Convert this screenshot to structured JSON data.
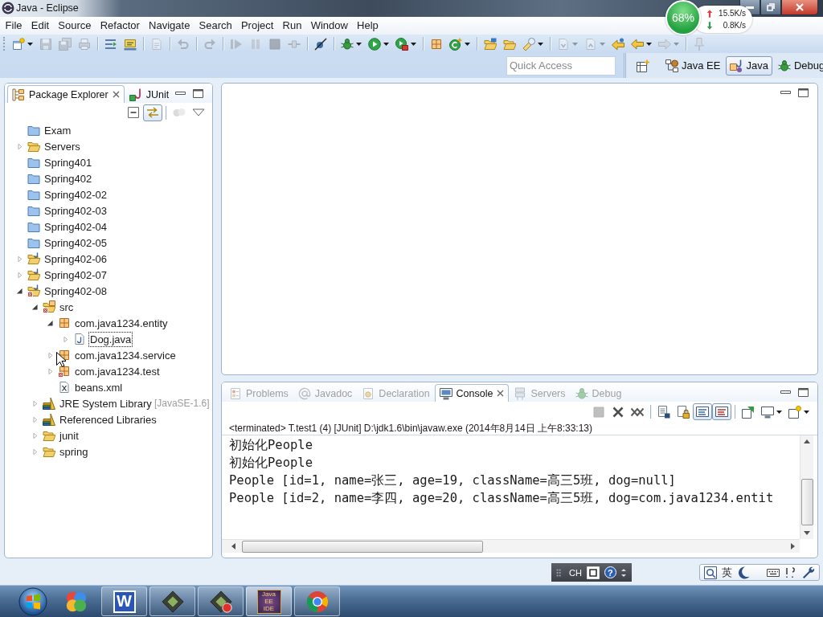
{
  "window": {
    "title": "Java - Eclipse"
  },
  "net_monitor": {
    "percent": "68%",
    "upload": "15.5K/s",
    "download": "0.8K/s"
  },
  "menu": [
    "File",
    "Edit",
    "Source",
    "Refactor",
    "Navigate",
    "Search",
    "Project",
    "Run",
    "Window",
    "Help"
  ],
  "toolbar": [
    [
      {
        "kind": "new",
        "disabled": false,
        "dropdown": true
      },
      {
        "kind": "save",
        "disabled": true,
        "dropdown": false
      },
      {
        "kind": "save-all",
        "disabled": true,
        "dropdown": false
      },
      {
        "kind": "print",
        "disabled": true,
        "dropdown": false
      }
    ],
    [
      {
        "kind": "lines",
        "disabled": false,
        "dropdown": false
      },
      {
        "kind": "tasks",
        "disabled": false,
        "dropdown": false
      }
    ],
    [
      {
        "kind": "page",
        "disabled": true,
        "dropdown": false
      }
    ],
    [
      {
        "kind": "undo",
        "disabled": true,
        "dropdown": false
      }
    ],
    [
      {
        "kind": "redo",
        "disabled": true,
        "dropdown": false
      }
    ],
    [
      {
        "kind": "resume",
        "disabled": true,
        "dropdown": false
      },
      {
        "kind": "suspend",
        "disabled": true,
        "dropdown": false
      },
      {
        "kind": "terminate",
        "disabled": true,
        "dropdown": false
      },
      {
        "kind": "disconnect",
        "disabled": true,
        "dropdown": false
      }
    ],
    [
      {
        "kind": "skip",
        "disabled": false,
        "dropdown": false
      }
    ],
    [
      {
        "kind": "debug",
        "disabled": false,
        "dropdown": true
      },
      {
        "kind": "run",
        "disabled": false,
        "dropdown": true
      },
      {
        "kind": "external",
        "disabled": false,
        "dropdown": true
      }
    ],
    [
      {
        "kind": "package",
        "disabled": false,
        "dropdown": false
      },
      {
        "kind": "class",
        "disabled": false,
        "dropdown": true
      }
    ],
    [
      {
        "kind": "open-type",
        "disabled": false,
        "dropdown": false
      },
      {
        "kind": "folder",
        "disabled": false,
        "dropdown": false
      },
      {
        "kind": "search",
        "disabled": false,
        "dropdown": true
      }
    ],
    [
      {
        "kind": "next",
        "disabled": true,
        "dropdown": true
      },
      {
        "kind": "prev",
        "disabled": true,
        "dropdown": true
      },
      {
        "kind": "last-edit",
        "disabled": false,
        "dropdown": false
      },
      {
        "kind": "back",
        "disabled": false,
        "dropdown": true
      },
      {
        "kind": "forward",
        "disabled": true,
        "dropdown": true
      }
    ],
    [
      {
        "kind": "pin",
        "disabled": true,
        "dropdown": false
      }
    ]
  ],
  "quick_access": {
    "placeholder": "Quick Access"
  },
  "perspectives": [
    {
      "kind": "javaee",
      "label": "Java EE",
      "selected": false
    },
    {
      "kind": "java",
      "label": "Java",
      "selected": true
    },
    {
      "kind": "debug",
      "label": "Debug",
      "selected": false
    }
  ],
  "package_explorer": {
    "tabs": [
      {
        "kind": "packages",
        "label": "Package Explorer",
        "selected": true
      },
      {
        "kind": "junit",
        "label": "JUnit",
        "selected": false
      }
    ],
    "view_toolbar": [
      [
        {
          "kind": "collapse",
          "disabled": false,
          "pressed": false
        },
        {
          "kind": "link",
          "disabled": false,
          "pressed": true
        }
      ],
      [
        {
          "kind": "focus",
          "disabled": true,
          "pressed": false
        },
        {
          "kind": "view-menu",
          "disabled": false,
          "pressed": false
        }
      ]
    ],
    "tree": [
      {
        "label": "Exam",
        "kind": "closed-project",
        "expandable": false,
        "expanded": false,
        "selected": false
      },
      {
        "label": "Servers",
        "kind": "open-project",
        "expandable": true,
        "expanded": false,
        "selected": false
      },
      {
        "label": "Spring401",
        "kind": "closed-project",
        "expandable": false,
        "expanded": false,
        "selected": false
      },
      {
        "label": "Spring402",
        "kind": "closed-project",
        "expandable": false,
        "expanded": false,
        "selected": false
      },
      {
        "label": "Spring402-02",
        "kind": "closed-project",
        "expandable": false,
        "expanded": false,
        "selected": false
      },
      {
        "label": "Spring402-03",
        "kind": "closed-project",
        "expandable": false,
        "expanded": false,
        "selected": false
      },
      {
        "label": "Spring402-04",
        "kind": "closed-project",
        "expandable": false,
        "expanded": false,
        "selected": false
      },
      {
        "label": "Spring402-05",
        "kind": "closed-project",
        "expandable": false,
        "expanded": false,
        "selected": false
      },
      {
        "label": "Spring402-06",
        "kind": "java-project",
        "expandable": true,
        "expanded": false,
        "selected": false
      },
      {
        "label": "Spring402-07",
        "kind": "java-project",
        "expandable": true,
        "expanded": false,
        "selected": false
      },
      {
        "label": "Spring402-08",
        "kind": "java-project-error",
        "expandable": true,
        "expanded": true,
        "selected": false,
        "children": [
          {
            "label": "src",
            "kind": "source-folder-error",
            "expandable": true,
            "expanded": true,
            "selected": false,
            "children": [
              {
                "label": "com.java1234.entity",
                "kind": "package",
                "expandable": true,
                "expanded": true,
                "selected": false,
                "children": [
                  {
                    "label": "Dog.java",
                    "kind": "java-file",
                    "expandable": true,
                    "expanded": false,
                    "selected": true
                  }
                ]
              },
              {
                "label": "com.java1234.service",
                "kind": "package",
                "expandable": true,
                "expanded": false,
                "selected": false
              },
              {
                "label": "com.java1234.test",
                "kind": "package-error",
                "expandable": true,
                "expanded": false,
                "selected": false
              },
              {
                "label": "beans.xml",
                "kind": "xml-file",
                "expandable": false,
                "expanded": false,
                "selected": false
              }
            ]
          },
          {
            "label": "JRE System Library",
            "decoration": "[JavaSE-1.6]",
            "kind": "library",
            "expandable": true,
            "expanded": false,
            "selected": false
          },
          {
            "label": "Referenced Libraries",
            "kind": "library",
            "expandable": true,
            "expanded": false,
            "selected": false
          },
          {
            "label": "junit",
            "kind": "folder",
            "expandable": true,
            "expanded": false,
            "selected": false
          },
          {
            "label": "spring",
            "kind": "folder",
            "expandable": true,
            "expanded": false,
            "selected": false
          }
        ]
      }
    ]
  },
  "console_view": {
    "tabs": [
      {
        "kind": "problems",
        "label": "Problems",
        "selected": false
      },
      {
        "kind": "javadoc",
        "label": "Javadoc",
        "selected": false
      },
      {
        "kind": "declaration",
        "label": "Declaration",
        "selected": false
      },
      {
        "kind": "console",
        "label": "Console",
        "selected": true
      },
      {
        "kind": "servers",
        "label": "Servers",
        "selected": false
      },
      {
        "kind": "debug",
        "label": "Debug",
        "selected": false
      }
    ],
    "toolbar": [
      [
        {
          "kind": "terminate",
          "disabled": true,
          "pressed": false,
          "dropdown": false
        },
        {
          "kind": "remove",
          "disabled": false,
          "pressed": false,
          "dropdown": false
        },
        {
          "kind": "remove-all",
          "disabled": false,
          "pressed": false,
          "dropdown": false
        }
      ],
      [
        {
          "kind": "clear",
          "disabled": false,
          "pressed": false,
          "dropdown": false
        },
        {
          "kind": "scroll-lock",
          "disabled": false,
          "pressed": false,
          "dropdown": false
        },
        {
          "kind": "stdout",
          "disabled": false,
          "pressed": true,
          "dropdown": false
        },
        {
          "kind": "stderr",
          "disabled": false,
          "pressed": true,
          "dropdown": false
        }
      ],
      [
        {
          "kind": "open",
          "disabled": false,
          "pressed": false,
          "dropdown": false
        },
        {
          "kind": "display",
          "disabled": false,
          "pressed": false,
          "dropdown": true
        },
        {
          "kind": "new-console",
          "disabled": false,
          "pressed": false,
          "dropdown": true
        }
      ]
    ],
    "status": "<terminated> T.test1 (4) [JUnit] D:\\jdk1.6\\bin\\javaw.exe (2014年8月14日 上午8:33:13)",
    "lines": [
      "初始化People",
      "初始化People",
      "People [id=1, name=张三, age=19, className=高三5班, dog=null]",
      "People [id=2, name=李四, age=20, className=高三5班, dog=com.java1234.entit"
    ]
  },
  "language_bar": {
    "language": "CH",
    "help": "?"
  },
  "ime_bar": {
    "mode": "英"
  },
  "taskbar": [
    {
      "kind": "pinwheel",
      "running": false,
      "active": false
    },
    {
      "kind": "letter",
      "label": "W",
      "running": true,
      "active": false
    },
    {
      "kind": "eclipse",
      "running": true,
      "active": false
    },
    {
      "kind": "eclipse-record",
      "running": true,
      "active": false
    },
    {
      "kind": "javaee",
      "label": "Java EE IDE",
      "running": true,
      "active": true
    },
    {
      "kind": "chrome",
      "running": true,
      "active": false
    }
  ]
}
